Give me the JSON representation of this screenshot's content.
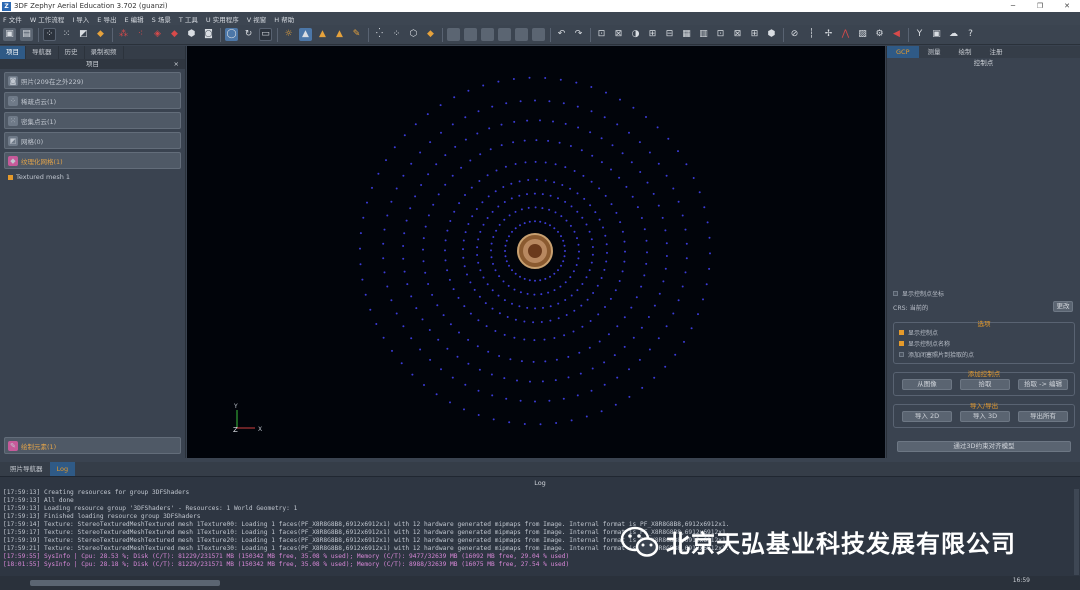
{
  "window": {
    "title": "3DF Zephyr Aerial Education 3.702 (guanzi)",
    "app_icon": "Z",
    "minimize": "─",
    "maximize": "❐",
    "close": "✕"
  },
  "menu": [
    "F 文件",
    "W 工作流程",
    "I 导入",
    "E 导出",
    "E 编辑",
    "S 场景",
    "T 工具",
    "U 实用程序",
    "V 视窗",
    "H 帮助"
  ],
  "left_panel": {
    "tabs": [
      "项目",
      "导航器",
      "历史",
      "录制视频"
    ],
    "active_tab": 0,
    "header": "项目",
    "close": "×",
    "groups": [
      {
        "label": "照片(209在之外229)",
        "icon": "camera-icon"
      },
      {
        "label": "稀疏点云(1)",
        "icon": "sparse-cloud-icon"
      },
      {
        "label": "密集点云(1)",
        "icon": "dense-cloud-icon"
      },
      {
        "label": "网格(0)",
        "icon": "mesh-icon"
      },
      {
        "label": "纹理化网格(1)",
        "icon": "textured-mesh-icon"
      }
    ],
    "mesh_item": "Textured mesh 1",
    "bottom_group": {
      "label": "绘制元素(1)",
      "icon": "draw-element-icon"
    }
  },
  "viewport": {
    "axis_y": "Y",
    "axis_z": "Z",
    "axis_x": "X",
    "point_color": "#3b3bd6"
  },
  "right_panel": {
    "tabs": [
      "GCP",
      "测量",
      "绘制",
      "注册"
    ],
    "active_tab": 0,
    "header": "控制点",
    "show_coords": "显示控制点坐标",
    "crs_label": "CRS: 当前的",
    "crs_button": "更改",
    "options_title": "选项",
    "options": [
      {
        "label": "显示控制点",
        "checked": true
      },
      {
        "label": "显示控制点名称",
        "checked": true
      },
      {
        "label": "添加闭塞照片到拾取的点",
        "checked": false
      }
    ],
    "add_title": "添加控制点",
    "add_buttons": [
      "从图像",
      "拾取",
      "拾取 -> 编辑"
    ],
    "io_title": "导入/导出",
    "io_buttons": [
      "导入 2D",
      "导入 3D",
      "导出所有"
    ],
    "bottom_button": "通过3D约束对齐模型"
  },
  "bottom_tabs": [
    "照片导航器",
    "Log"
  ],
  "active_bottom_tab": 1,
  "log": {
    "title": "Log",
    "lines": [
      "[17:59:13] Creating resources for group 3DFShaders",
      "[17:59:13] All done",
      "[17:59:13] Loading resource group '3DFShaders' - Resources: 1 World Geometry: 1",
      "[17:59:13] Finished loading resource group 3DFShaders",
      "[17:59:14] Texture: StereoTexturedMeshTextured mesh 1Texture00: Loading 1 faces(PF_X8R8G8B8,6912x6912x1) with 12 hardware generated mipmaps from Image. Internal format is PF_X8R8G8B8,6912x6912x1.",
      "[17:59:17] Texture: StereoTexturedMeshTextured mesh 1Texture10: Loading 1 faces(PF_X8R8G8B8,6912x6912x1) with 12 hardware generated mipmaps from Image. Internal format is PF_X8R8G8B8,6912x6912x1.",
      "[17:59:19] Texture: StereoTexturedMeshTextured mesh 1Texture20: Loading 1 faces(PF_X8R8G8B8,6912x6912x1) with 12 hardware generated mipmaps from Image. Internal format is PF_X8R8G8B8,6912x6912x1.",
      "[17:59:21] Texture: StereoTexturedMeshTextured mesh 1Texture30: Loading 1 faces(PF_X8R8G8B8,6912x6912x1) with 12 hardware generated mipmaps from Image. Internal format is PF_X8R8G8B8,6912x6912x1.",
      "[17:59:55] SysInfo | Cpu: 28.53 %; Disk (C/T): 81229/231571 MB (150342 MB free, 35.08 % used); Memory (C/T): 9477/32639 MB (16092 MB free, 29.04 % used)",
      "[18:01:55] SysInfo | Cpu: 28.18 %; Disk (C/T): 81229/231571 MB (150342 MB free, 35.08 % used); Memory (C/T): 8988/32639 MB (16075 MB free, 27.54 % used)"
    ],
    "highlight_lines": [
      8,
      9
    ]
  },
  "status": {
    "right_text": "16:59"
  },
  "watermark": {
    "text": "北京天弘基业科技发展有限公司",
    "icon": "wechat-icon"
  }
}
